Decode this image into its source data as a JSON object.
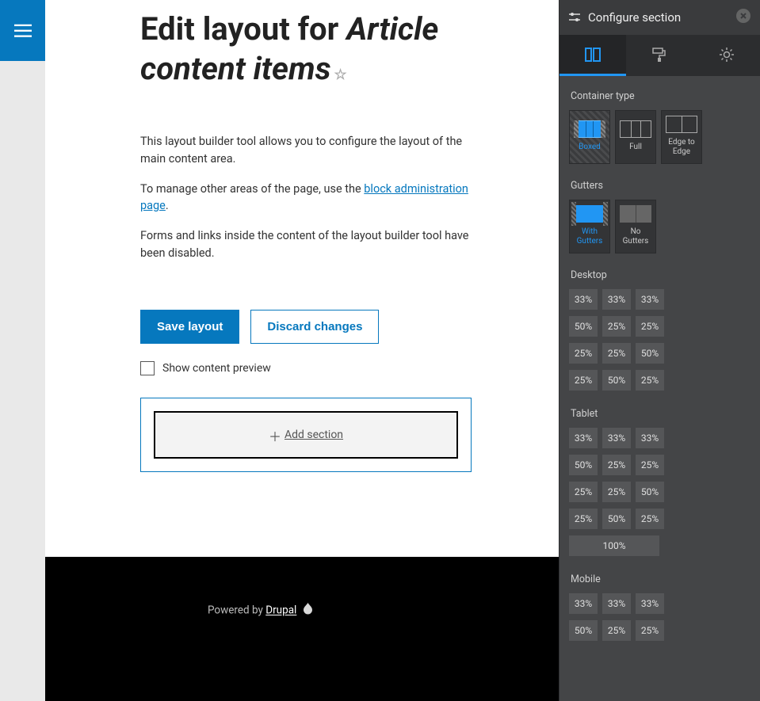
{
  "header": {
    "title_prefix": "Edit layout for",
    "title_italic": "Article content items"
  },
  "desc": {
    "p1": "This layout builder tool allows you to configure the layout of the main content area.",
    "p2a": "To manage other areas of the page, use the ",
    "p2_link": "block administration page",
    "p2b": ".",
    "p3": "Forms and links inside the content of the layout builder tool have been disabled."
  },
  "actions": {
    "save": "Save layout",
    "discard": "Discard changes",
    "preview_label": "Show content preview",
    "add_section": "Add section"
  },
  "footer": {
    "powered": "Powered by ",
    "drupal": "Drupal"
  },
  "panel": {
    "title": "Configure section",
    "groups": {
      "container": "Container type",
      "gutters": "Gutters",
      "desktop": "Desktop",
      "tablet": "Tablet",
      "mobile": "Mobile"
    },
    "container_opts": {
      "boxed": "Boxed",
      "full": "Full",
      "edge": "Edge to Edge"
    },
    "gutter_opts": {
      "with": "With Gutters",
      "without": "No Gutters"
    },
    "desktop_rows": [
      [
        "33%",
        "33%",
        "33%"
      ],
      [
        "50%",
        "25%",
        "25%"
      ],
      [
        "25%",
        "25%",
        "50%"
      ],
      [
        "25%",
        "50%",
        "25%"
      ]
    ],
    "tablet_rows": [
      [
        "33%",
        "33%",
        "33%"
      ],
      [
        "50%",
        "25%",
        "25%"
      ],
      [
        "25%",
        "25%",
        "50%"
      ],
      [
        "25%",
        "50%",
        "25%"
      ],
      [
        "100%"
      ]
    ],
    "mobile_rows": [
      [
        "33%",
        "33%",
        "33%"
      ],
      [
        "50%",
        "25%",
        "25%"
      ]
    ]
  }
}
